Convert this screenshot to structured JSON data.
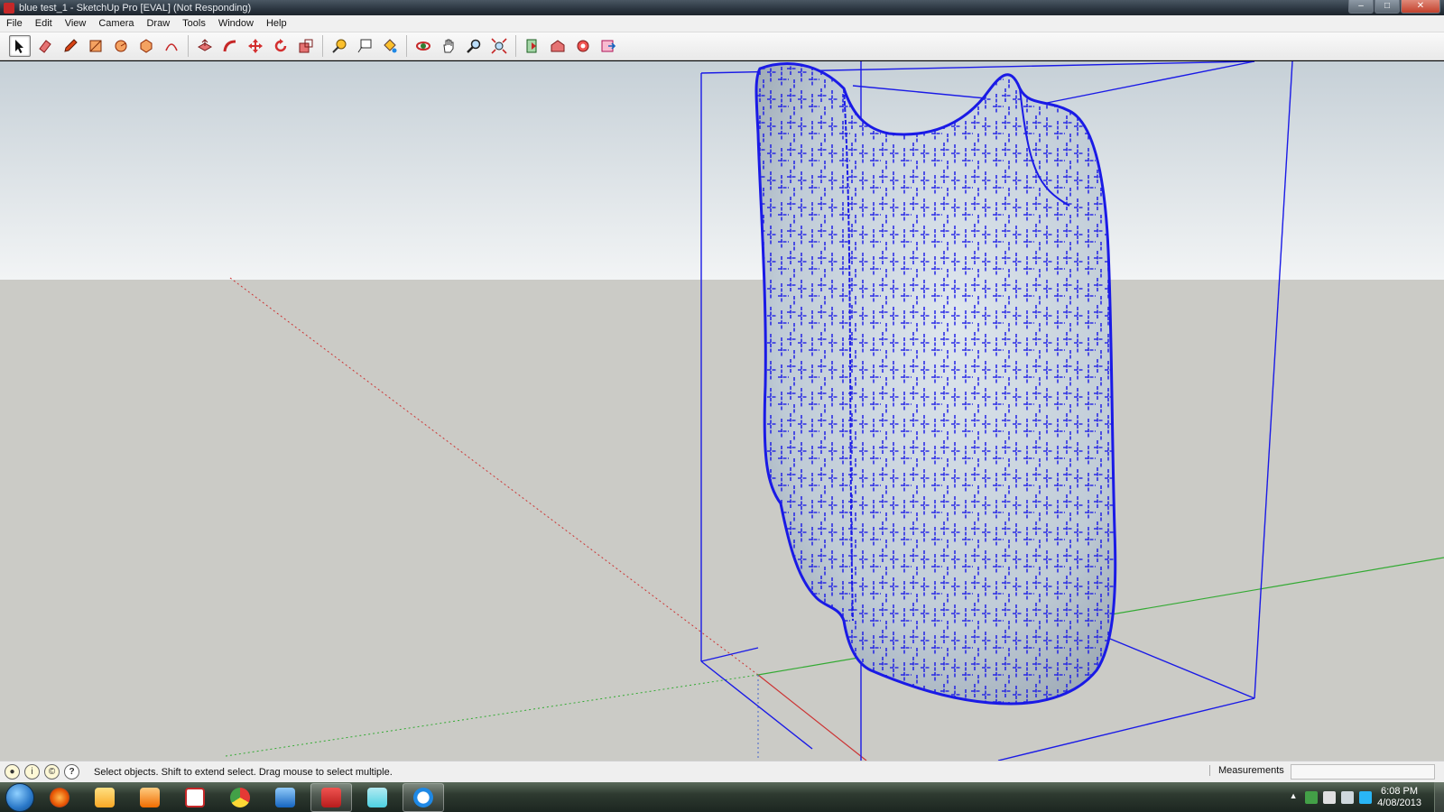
{
  "window": {
    "title": "blue test_1 - SketchUp Pro [EVAL] (Not Responding)",
    "controls": [
      "–",
      "□",
      "✕"
    ]
  },
  "menu": [
    "File",
    "Edit",
    "View",
    "Camera",
    "Draw",
    "Tools",
    "Window",
    "Help"
  ],
  "toolbar": {
    "tools": [
      {
        "name": "select-tool",
        "icon": "arrow-cursor-icon",
        "active": true
      },
      {
        "name": "eraser-tool",
        "icon": "eraser-icon"
      },
      {
        "name": "pencil-tool",
        "icon": "pencil-icon"
      },
      {
        "name": "rectangle-tool",
        "icon": "rectangle-icon"
      },
      {
        "name": "circle-tool",
        "icon": "circle-icon"
      },
      {
        "name": "polygon-tool",
        "icon": "polygon-icon"
      },
      {
        "name": "arc-tool",
        "icon": "arc-icon"
      },
      {
        "name": "push-pull-tool",
        "icon": "push-pull-icon"
      },
      {
        "name": "follow-me-tool",
        "icon": "follow-me-icon"
      },
      {
        "name": "move-tool",
        "icon": "move-icon"
      },
      {
        "name": "rotate-tool",
        "icon": "rotate-icon"
      },
      {
        "name": "scale-tool",
        "icon": "scale-icon"
      },
      {
        "name": "tape-measure-tool",
        "icon": "tape-measure-icon"
      },
      {
        "name": "text-tool",
        "icon": "text-icon"
      },
      {
        "name": "paint-bucket-tool",
        "icon": "paint-bucket-icon"
      },
      {
        "name": "orbit-tool",
        "icon": "orbit-icon"
      },
      {
        "name": "pan-tool",
        "icon": "pan-hand-icon"
      },
      {
        "name": "zoom-tool",
        "icon": "zoom-icon"
      },
      {
        "name": "zoom-extents-tool",
        "icon": "zoom-extents-icon"
      },
      {
        "name": "section-plane-tool",
        "icon": "section-plane-icon"
      },
      {
        "name": "warehouse-tool",
        "icon": "warehouse-icon"
      },
      {
        "name": "extension-warehouse-tool",
        "icon": "extension-warehouse-icon"
      },
      {
        "name": "send-to-layout-tool",
        "icon": "send-to-layout-icon"
      }
    ]
  },
  "status": {
    "hint": "Select objects. Shift to extend select. Drag mouse to select multiple.",
    "measurements_label": "Measurements",
    "measurements_value": ""
  },
  "taskbar": {
    "apps": [
      "firefox",
      "explorer",
      "media-player",
      "acrobat",
      "chrome",
      "downloader",
      "sketchup",
      "notes",
      "clock-app"
    ],
    "time": "6:08 PM",
    "date": "4/08/2013"
  },
  "colors": {
    "sky": "#c9d3da",
    "ground": "#cbcbc6",
    "model_edges": "#1a1ae6",
    "model_face": "#c5d2de",
    "axis_red": "#cc3333",
    "axis_green": "#33aa33"
  }
}
